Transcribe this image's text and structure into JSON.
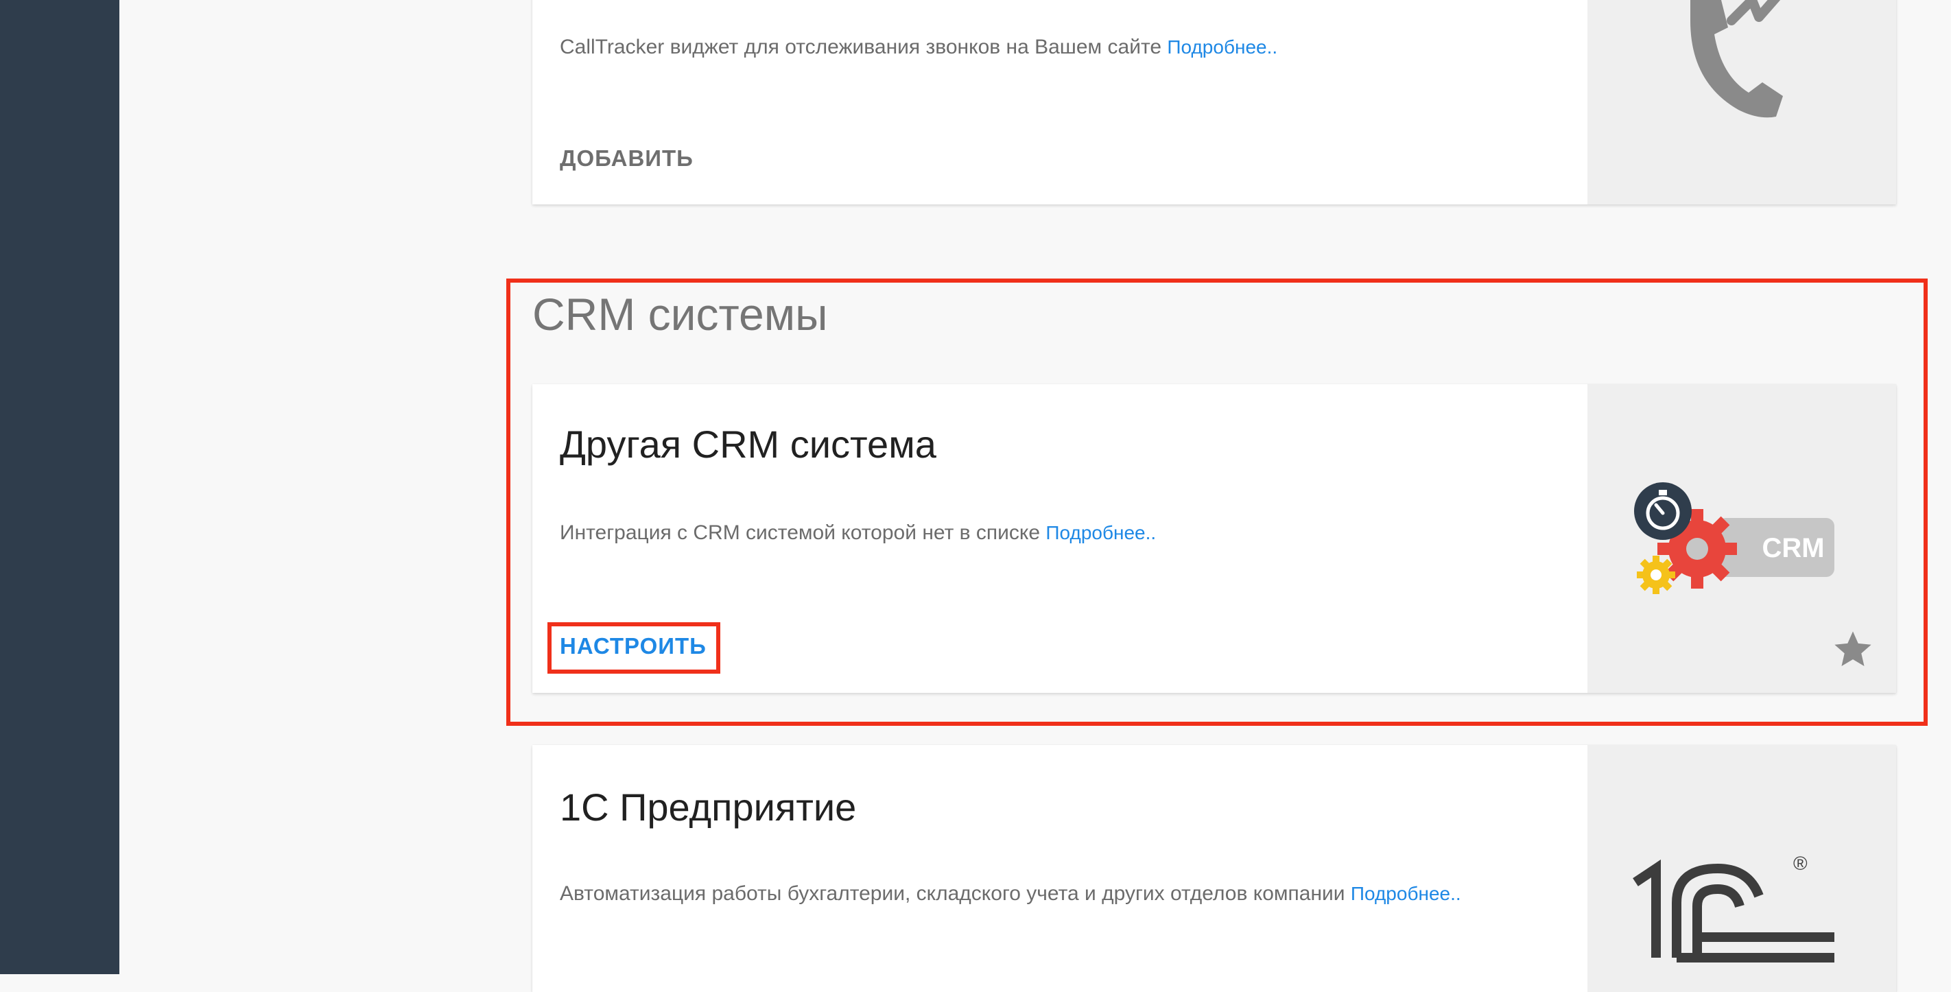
{
  "sidebar": {},
  "cards": {
    "calltracker": {
      "description": "CallTracker виджет для отслеживания звонков на Вашем сайте",
      "more_link": "Подробнее..",
      "action_label": "ДОБАВИТЬ",
      "icon": "phone-icon"
    },
    "other_crm": {
      "title": "Другая CRM система",
      "description": "Интеграция с CRM системой которой нет в списке",
      "more_link": "Подробнее..",
      "action_label": "НАСТРОИТЬ",
      "logo_text": "CRM",
      "icon": "crm-gear-logo",
      "favorite_icon": "star-icon"
    },
    "one_c": {
      "title": "1С Предприятие",
      "description": "Автоматизация работы бухгалтерии, складского учета и других отделов компании",
      "more_link": "Подробнее..",
      "logo_text": "1С",
      "logo_mark": "®"
    }
  },
  "sections": {
    "crm": {
      "title": "CRM системы"
    }
  },
  "colors": {
    "sidebar": "#2f3d4c",
    "accent": "#1e88e5",
    "highlight": "#f0301a",
    "icon_gray": "#8a8a8a",
    "gear_red": "#e8453c",
    "gear_yellow": "#f5c21a"
  }
}
